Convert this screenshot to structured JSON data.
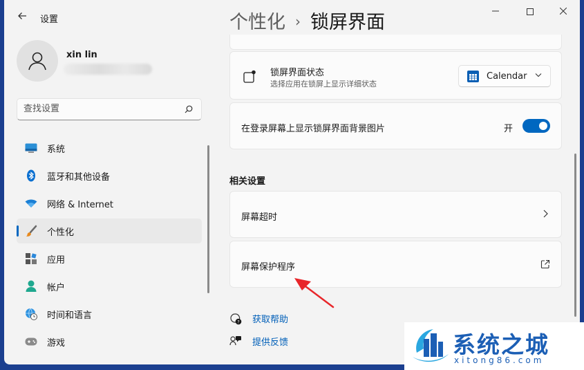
{
  "app": {
    "title": "设置"
  },
  "profile": {
    "name": "xin lin"
  },
  "search": {
    "placeholder": "查找设置"
  },
  "sidebar": {
    "items": [
      {
        "label": "系统",
        "icon": "monitor-icon"
      },
      {
        "label": "蓝牙和其他设备",
        "icon": "bluetooth-icon"
      },
      {
        "label": "网络 & Internet",
        "icon": "wifi-icon"
      },
      {
        "label": "个性化",
        "icon": "brush-icon",
        "active": true
      },
      {
        "label": "应用",
        "icon": "apps-icon"
      },
      {
        "label": "帐户",
        "icon": "account-icon"
      },
      {
        "label": "时间和语言",
        "icon": "globe-clock-icon"
      },
      {
        "label": "游戏",
        "icon": "gamepad-icon"
      }
    ]
  },
  "header": {
    "parent": "个性化",
    "separator": "›",
    "current": "锁屏界面"
  },
  "lock_status": {
    "title": "锁屏界面状态",
    "subtitle": "选择应用在锁屏上显示详细状态",
    "dropdown_value": "Calendar"
  },
  "show_background": {
    "title": "在登录屏幕上显示锁屏界面背景图片",
    "toggle_label": "开",
    "toggle_on": true
  },
  "related": {
    "title": "相关设置",
    "items": [
      {
        "label": "屏幕超时"
      },
      {
        "label": "屏幕保护程序"
      }
    ]
  },
  "links": {
    "help": "获取帮助",
    "feedback": "提供反馈"
  },
  "watermark": {
    "title": "系统之城",
    "url": "xitong86.com"
  },
  "colors": {
    "accent": "#0067c0",
    "link": "#005fb8",
    "annotation_arrow": "#e8262a"
  }
}
